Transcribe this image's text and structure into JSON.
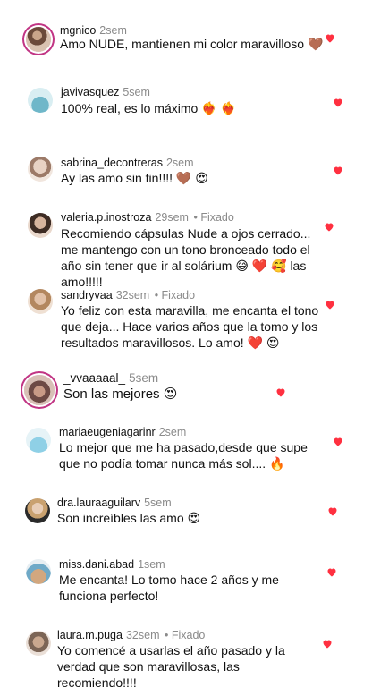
{
  "comments": [
    {
      "user": "mgnico",
      "time": "2sem",
      "pinned": "",
      "text": "Amo NUDE, mantienen mi color maravilloso 🤎"
    },
    {
      "user": "javivasquez",
      "time": "5sem",
      "pinned": "",
      "text": "100% real, es lo máximo ❤️‍🔥 ❤️‍🔥"
    },
    {
      "user": "sabrina_decontreras",
      "time": "2sem",
      "pinned": "",
      "text": "Ay las amo sin fin!!!! 🤎 😍"
    },
    {
      "user": "valeria.p.inostroza",
      "time": "29sem",
      "pinned": "Fixado",
      "text": "Recomiendo cápsulas Nude a ojos cerrado... me mantengo con un tono bronceado todo el año sin tener que ir al solárium 😅 ❤️ 🥰 las amo!!!!!"
    },
    {
      "user": "sandryvaa",
      "time": "32sem",
      "pinned": "Fixado",
      "text": "Yo feliz con esta maravilla, me encanta el tono que deja... Hace varios años que la tomo y los resultados maravillosos. Lo amo! ❤️ 😍"
    },
    {
      "user": "_vvaaaaal_",
      "time": "5sem",
      "pinned": "",
      "text": "Son las mejores 😍"
    },
    {
      "user": "mariaeugeniagarinr",
      "time": "2sem",
      "pinned": "",
      "text": "Lo mejor que me ha pasado,desde que supe que no podía tomar nunca más sol.... 🔥"
    },
    {
      "user": "dra.lauraaguilarv",
      "time": "5sem",
      "pinned": "",
      "text": "Son increíbles las amo 😍"
    },
    {
      "user": "miss.dani.abad",
      "time": "1sem",
      "pinned": "",
      "text": "Me encanta! Lo tomo hace 2 años y me funciona perfecto!"
    },
    {
      "user": "laura.m.puga",
      "time": "32sem",
      "pinned": "Fixado",
      "text": "Yo comencé a usarlas el año pasado y la verdad que son maravillosas, las recomiendo!!!!"
    }
  ],
  "colors": {
    "heart": "#ff3040",
    "muted": "#8a8a8a",
    "story_ring": "#c13584"
  },
  "icons": {
    "like": "heart-icon",
    "avatar": "avatar"
  }
}
